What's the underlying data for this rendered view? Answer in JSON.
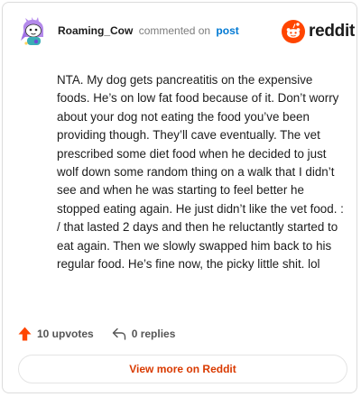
{
  "header": {
    "username": "Roaming_Cow",
    "action_text": "commented on",
    "post_link": "post",
    "brand_name": "reddit",
    "avatar_icon": "snoo-avatar-icon",
    "brand_icon": "reddit-alien-icon"
  },
  "comment": {
    "text": "NTA. My dog gets pancreatitis on the expensive foods. He’s on low fat food because of it. Don’t worry about your dog not eating the food you’ve been providing though. They’ll cave eventually. The vet prescribed some diet food when he decided to just wolf down some random thing on a walk that I didn’t see and when he was starting to feel better he stopped eating again. He just didn’t like the vet food. : / that lasted 2 days and then he reluctantly started to eat again. Then we slowly swapped him back to his regular food. He’s fine now, the picky little shit. lol"
  },
  "meta": {
    "upvotes_label": "10 upvotes",
    "replies_label": "0 replies",
    "upvote_icon": "upvote-arrow-icon",
    "reply_icon": "reply-arrow-icon"
  },
  "footer": {
    "view_more_label": "View more on Reddit"
  },
  "colors": {
    "brand_orange": "#ff4500",
    "link_blue": "#0079d3",
    "button_text": "#d93a00",
    "avatar_purple": "#b48aeb"
  }
}
